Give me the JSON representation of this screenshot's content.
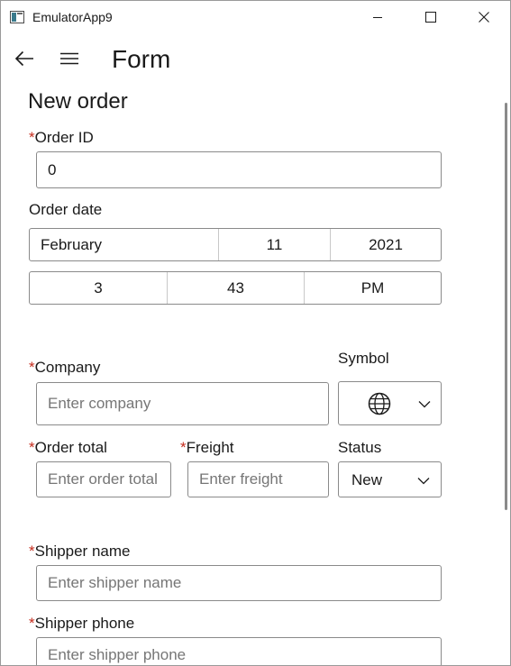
{
  "window": {
    "title": "EmulatorApp9"
  },
  "nav": {
    "page_title": "Form"
  },
  "form": {
    "heading": "New order",
    "required_marker": "*",
    "order_id": {
      "label": "Order ID",
      "value": "0"
    },
    "order_date": {
      "label": "Order date",
      "month": "February",
      "day": "11",
      "year": "2021",
      "hour": "3",
      "minute": "43",
      "period": "PM"
    },
    "company": {
      "label": "Company",
      "placeholder": "Enter company"
    },
    "symbol": {
      "label": "Symbol",
      "icon": "globe-icon"
    },
    "order_total": {
      "label": "Order total",
      "placeholder": "Enter order total"
    },
    "freight": {
      "label": "Freight",
      "placeholder": "Enter freight"
    },
    "status": {
      "label": "Status",
      "value": "New"
    },
    "shipper_name": {
      "label": "Shipper name",
      "placeholder": "Enter shipper name"
    },
    "shipper_phone": {
      "label": "Shipper phone",
      "placeholder": "Enter shipper phone"
    }
  }
}
